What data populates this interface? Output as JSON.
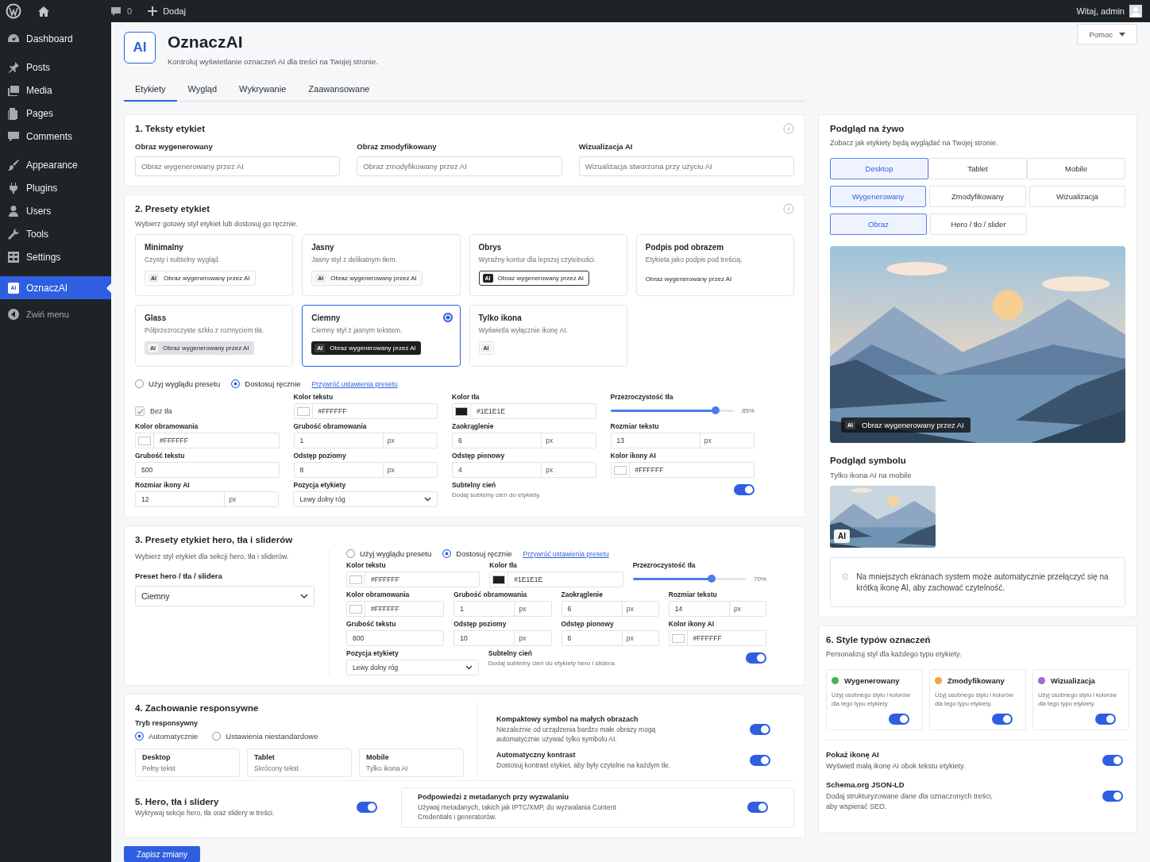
{
  "admin_bar": {
    "comments_count": "0",
    "add_new": "Dodaj",
    "greeting": "Witaj, admin"
  },
  "sidebar": {
    "items": [
      {
        "label": "Dashboard",
        "selected": false
      },
      {
        "label": "Posts",
        "selected": false
      },
      {
        "label": "Media",
        "selected": false
      },
      {
        "label": "Pages",
        "selected": false
      },
      {
        "label": "Comments",
        "selected": false
      },
      {
        "label": "Appearance",
        "selected": false
      },
      {
        "label": "Plugins",
        "selected": false
      },
      {
        "label": "Users",
        "selected": false
      },
      {
        "label": "Tools",
        "selected": false
      },
      {
        "label": "Settings",
        "selected": false
      },
      {
        "label": "OznaczAI",
        "selected": true,
        "badge": "AI"
      }
    ],
    "collapse": "Zwiń menu"
  },
  "header": {
    "logo": "AI",
    "title": "OznaczAI",
    "subtitle": "Kontroluj wyświetlanie oznaczeń AI dla treści na Twojej stronie.",
    "help": "Pomoc"
  },
  "tabs": [
    {
      "label": "Etykiety",
      "selected": true
    },
    {
      "label": "Wygląd",
      "selected": false
    },
    {
      "label": "Wykrywanie",
      "selected": false
    },
    {
      "label": "Zaawansowane",
      "selected": false
    }
  ],
  "texts_section": {
    "title": "1. Teksty etykiet",
    "fields": [
      {
        "label": "Obraz wygenerowany",
        "placeholder": "Obraz wygenerowany przez AI"
      },
      {
        "label": "Obraz zmodyfikowany",
        "placeholder": "Obraz zmodyfikowany przez AI"
      },
      {
        "label": "Wizualizacja AI",
        "placeholder": "Wizualizacja stworzona przy użyciu AI"
      }
    ]
  },
  "presets_section": {
    "title": "2. Presety etykiet",
    "description": "Wybierz gotowy styl etykiet lub dostosuj go ręcznie.",
    "presets": [
      {
        "kind": "minimal",
        "name": "Minimalny",
        "description": "Czysty i subtelny wygląd.",
        "badge": "AI",
        "sample": "Obraz wygenerowany przez AI",
        "selected": false
      },
      {
        "kind": "light",
        "name": "Jasny",
        "description": "Jasny styl z delikatnym tłem.",
        "badge": "AI",
        "sample": "Obraz wygenerowany przez AI",
        "selected": false
      },
      {
        "kind": "outline",
        "name": "Obrys",
        "description": "Wyraźny kontur dla lepszej czytelności.",
        "badge": "AI",
        "sample": "Obraz wygenerowany przez AI",
        "selected": false
      },
      {
        "kind": "caption",
        "name": "Podpis pod obrazem",
        "description": "Etykieta jako podpis pod treścią.",
        "sample": "Obraz wygenerowany przez AI",
        "selected": false
      },
      {
        "kind": "glass",
        "name": "Glass",
        "description": "Półprzezroczyste szkło z rozmyciem tła.",
        "badge": "AI",
        "sample": "Obraz wygenerowany przez AI",
        "selected": false
      },
      {
        "kind": "dark",
        "name": "Ciemny",
        "description": "Ciemny styl z jasnym tekstem.",
        "badge": "AI",
        "sample": "Obraz wygenerowany przez AI",
        "selected": true
      },
      {
        "kind": "icon",
        "name": "Tylko ikona",
        "description": "Wyświetla wyłącznie ikonę AI.",
        "badge": "AI",
        "selected": false
      }
    ],
    "modes": [
      {
        "label": "Użyj wyglądu presetu",
        "selected": false
      },
      {
        "label": "Dostosuj ręcznie",
        "selected": true
      }
    ],
    "reset_link": "Przywróć ustawienia presetu",
    "settings": [
      [
        {
          "kind": "checkbox",
          "label": "Bez tła",
          "checked": true,
          "disabled": true
        },
        {
          "kind": "color",
          "label": "Kolor tekstu",
          "value": "#FFFFFF",
          "color": "#ffffff"
        },
        {
          "kind": "color",
          "label": "Kolor tła",
          "value": "#1E1E1E",
          "color": "#1e1e1e"
        },
        {
          "kind": "slider",
          "label": "Przezroczystość tła",
          "level": 0.85,
          "reading": "85%"
        }
      ],
      [
        {
          "kind": "color",
          "label": "Kolor obramowania",
          "value": "#FFFFFF",
          "color": "#ffffff"
        },
        {
          "kind": "number",
          "label": "Grubość obramowania",
          "value": "1",
          "unit": "px"
        },
        {
          "kind": "number",
          "label": "Zaokrąglenie",
          "value": "6",
          "unit": "px"
        },
        {
          "kind": "number",
          "label": "Rozmiar tekstu",
          "value": "13",
          "unit": "px"
        }
      ],
      [
        {
          "kind": "text",
          "label": "Grubość tekstu",
          "value": "500"
        },
        {
          "kind": "number",
          "label": "Odstęp poziomy",
          "value": "8",
          "unit": "px"
        },
        {
          "kind": "number",
          "label": "Odstęp pionowy",
          "value": "4",
          "unit": "px"
        },
        {
          "kind": "color",
          "label": "Kolor ikony AI",
          "value": "#FFFFFF",
          "color": "#ffffff"
        }
      ],
      [
        {
          "kind": "number",
          "label": "Rozmiar ikony AI",
          "value": "12",
          "unit": "px"
        },
        {
          "kind": "select",
          "label": "Pozycja etykiety",
          "value": "Lewy dolny róg"
        },
        {
          "kind": "toggle",
          "label": "Subtelny cień",
          "description": "Dodaj subtelny cień do etykiety.",
          "on": true
        }
      ]
    ]
  },
  "hero_section": {
    "title": "3. Presety etykiet hero, tła i sliderów",
    "description": "Wybierz styl etykiet dla sekcji hero, tła i sliderów.",
    "preset_select": {
      "label": "Preset hero / tła / slidera",
      "value": "Ciemny"
    },
    "modes": [
      {
        "label": "Użyj wyglądu presetu",
        "selected": false
      },
      {
        "label": "Dostosuj ręcznie",
        "selected": true
      }
    ],
    "reset_link": "Przywróć ustawienia presetu",
    "settings": [
      [
        {
          "kind": "color",
          "label": "Kolor tekstu",
          "value": "#FFFFFF",
          "color": "#ffffff"
        },
        {
          "kind": "color",
          "label": "Kolor tła",
          "value": "#1E1E1E",
          "color": "#1e1e1e"
        },
        {
          "kind": "slider",
          "label": "Przezroczystość tła",
          "level": 0.7,
          "reading": "70%"
        }
      ],
      [
        {
          "kind": "color",
          "label": "Kolor obramowania",
          "value": "#FFFFFF",
          "color": "#ffffff"
        },
        {
          "kind": "number",
          "label": "Grubość obramowania",
          "value": "1",
          "unit": "px"
        },
        {
          "kind": "number",
          "label": "Zaokrąglenie",
          "value": "6",
          "unit": "px"
        },
        {
          "kind": "number",
          "label": "Rozmiar tekstu",
          "value": "14",
          "unit": "px"
        }
      ],
      [
        {
          "kind": "text",
          "label": "Grubość tekstu",
          "value": "600"
        },
        {
          "kind": "number",
          "label": "Odstęp poziomy",
          "value": "10",
          "unit": "px"
        },
        {
          "kind": "number",
          "label": "Odstęp pionowy",
          "value": "6",
          "unit": "px"
        },
        {
          "kind": "color",
          "label": "Kolor ikony AI",
          "value": "#FFFFFF",
          "color": "#ffffff"
        }
      ],
      [
        {
          "kind": "select",
          "label": "Pozycja etykiety",
          "value": "Lewy dolny róg"
        },
        {
          "kind": "toggle",
          "label": "Subtelny cień",
          "description": "Dodaj subtelny cień do etykiety hero i slidera.",
          "on": true
        }
      ]
    ]
  },
  "responsive_section": {
    "title": "4. Zachowanie responsywne",
    "mode_label": "Tryb responsywny",
    "modes": [
      {
        "label": "Automatycznie",
        "selected": true
      },
      {
        "label": "Ustawienia niestandardowe",
        "selected": false
      }
    ],
    "devices": [
      {
        "name": "Desktop",
        "value": "Pełny tekst"
      },
      {
        "name": "Tablet",
        "value": "Skrócony tekst"
      },
      {
        "name": "Mobile",
        "value": "Tylko ikona AI"
      }
    ],
    "options": [
      {
        "title": "Kompaktowy symbol na małych obrazach",
        "description": "Niezależnie od urządzenia bardzo małe obrazy mogą automatycznie używać tylko symbolu AI.",
        "on": true
      },
      {
        "title": "Automatyczny kontrast",
        "description": "Dostosuj kontrast etykiet, aby były czytelne na każdym tle.",
        "on": true
      }
    ]
  },
  "hero_detect_section": {
    "title": "5. Hero, tła i slidery",
    "description": "Wykrywaj sekcje hero, tła oraz slidery w treści.",
    "on": true,
    "hint": {
      "title": "Podpowiedzi z metadanych przy wyzwalaniu",
      "description": "Używaj metadanych, takich jak IPTC/XMP, do wyzwalania Content Credentials i generatorów.",
      "on": true
    }
  },
  "save_button": "Zapisz zmiany",
  "preview": {
    "title": "Podgląd na żywo",
    "subtitle": "Zobacz jak etykiety będą wyglądać na Twojej stronie.",
    "devices": [
      {
        "label": "Desktop",
        "selected": true
      },
      {
        "label": "Tablet",
        "selected": false
      },
      {
        "label": "Mobile",
        "selected": false
      }
    ],
    "types": [
      {
        "label": "Wygenerowany",
        "selected": true
      },
      {
        "label": "Zmodyfikowany",
        "selected": false
      },
      {
        "label": "Wizualizacja",
        "selected": false
      }
    ],
    "targets": [
      {
        "label": "Obraz",
        "selected": true
      },
      {
        "label": "Hero / tło / slider",
        "selected": false
      }
    ],
    "label_badge": "AI",
    "label_text": "Obraz wygenerowany przez AI",
    "symbol_title": "Podgląd symbolu",
    "symbol_subtitle": "Tylko ikona AI na mobile",
    "symbol_badge": "AI",
    "notice": "Na mniejszych ekranach system może automatycznie przełączyć się na krótką ikonę AI, aby zachować czytelność."
  },
  "types_section": {
    "title": "6. Style typów oznaczeń",
    "description": "Personalizuj styl dla każdego typu etykiety.",
    "types": [
      {
        "name": "Wygenerowany",
        "color": "#4caf50",
        "description": "Użyj osobnego stylu i kolorów dla tego typu etykiety.",
        "on": true
      },
      {
        "name": "Zmodyfikowany",
        "color": "#f5a04a",
        "description": "Użyj osobnego stylu i kolorów dla tego typu etykiety.",
        "on": true
      },
      {
        "name": "Wizualizacja",
        "color": "#a36ad6",
        "description": "Użyj osobnego stylu i kolorów dla tego typu etykiety.",
        "on": true
      }
    ],
    "options": [
      {
        "title": "Pokaż ikonę AI",
        "description": "Wyświetl małą ikonę AI obok tekstu etykiety.",
        "on": true
      },
      {
        "title": "Schema.org JSON-LD",
        "description": "Dodaj strukturyzowane dane dla oznaczonych treści, aby wspierać SEO.",
        "on": true
      }
    ]
  }
}
